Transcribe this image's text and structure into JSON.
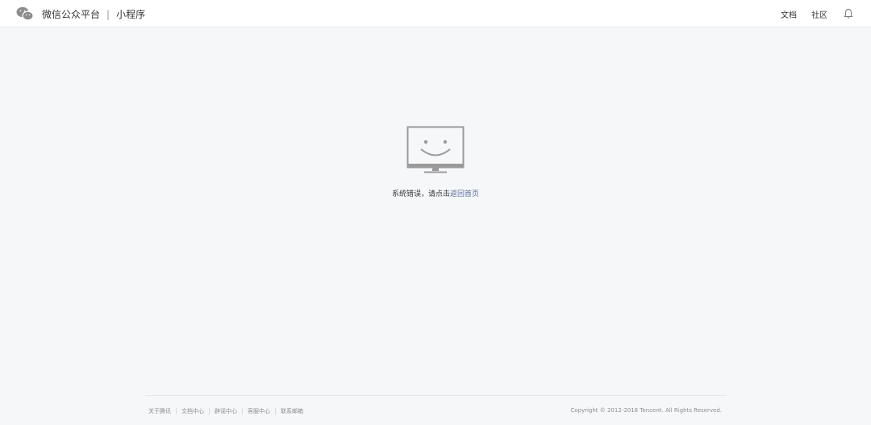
{
  "header": {
    "brand_name": "微信公众平台",
    "separator": "|",
    "product_name": "小程序",
    "logo_icon": "wechat-icon",
    "links": [
      "文档",
      "社区"
    ],
    "notification_icon": "bell-icon"
  },
  "main": {
    "illustration_icon": "smiling-monitor-icon",
    "message_prefix": "系统错误，请点击",
    "message_link": "返回首页"
  },
  "footer": {
    "links": [
      "关于腾讯",
      "文档中心",
      "辟谣中心",
      "客服中心",
      "联系邮箱"
    ],
    "copyright": "Copyright © 2012-2018 Tencent. All Rights Reserved."
  },
  "colors": {
    "background": "#f6f7f9",
    "link": "#576b95",
    "icon_gray": "#9a9a9a"
  }
}
